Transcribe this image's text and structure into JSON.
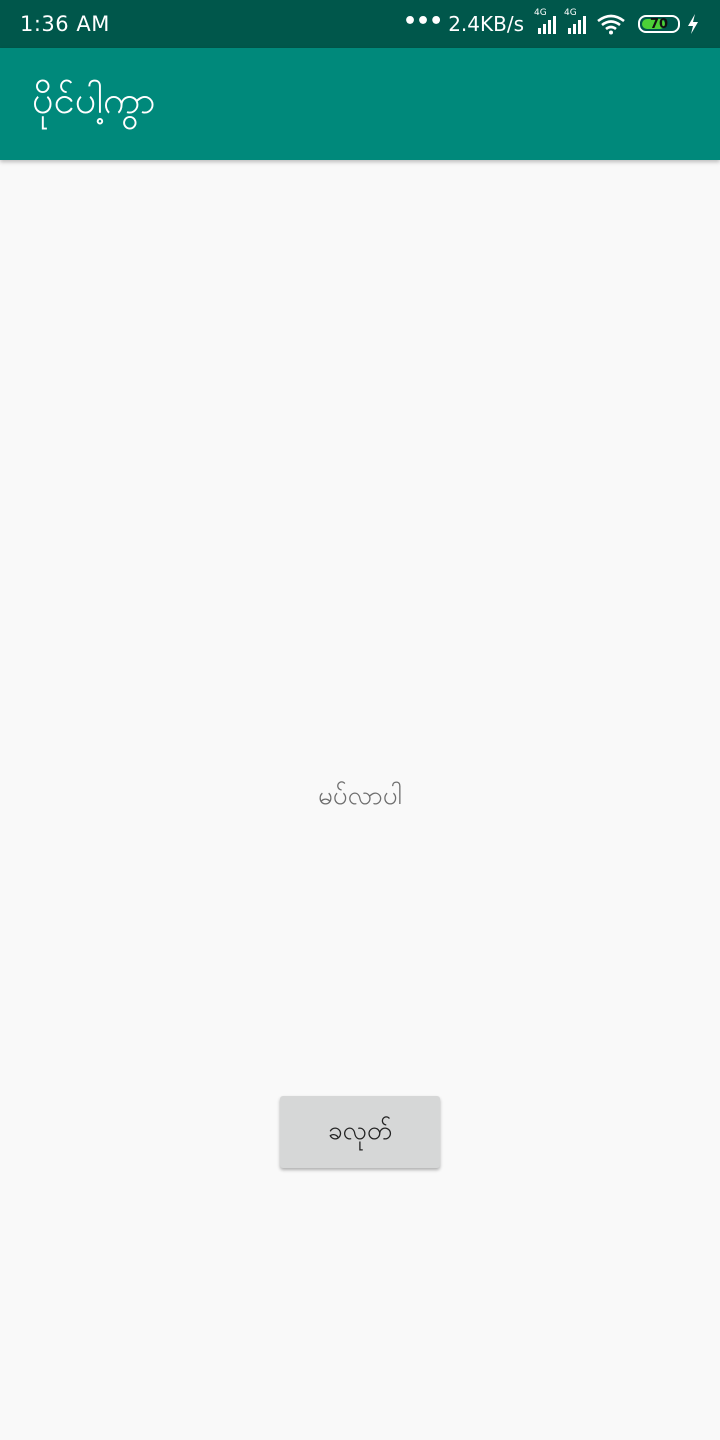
{
  "status_bar": {
    "time": "1:36 AM",
    "network_speed": "2.4KB/s",
    "sim1_type": "4G",
    "sim2_type": "4G",
    "battery_level": "70",
    "battery_fraction": 0.7,
    "icons": [
      "more-dots-icon",
      "signal-icon",
      "signal-icon",
      "wifi-icon",
      "battery-icon",
      "charging-icon"
    ]
  },
  "app_bar": {
    "title": "ပိုင်ပါ့ကွာ"
  },
  "main": {
    "message": "မပ်လာပါ",
    "button_label": "ခလုတ်"
  },
  "colors": {
    "status_bar": "#00574b",
    "app_bar": "#00897b",
    "background": "#f9f9f9",
    "button": "#d6d7d7",
    "battery_fill": "#4cd137"
  }
}
